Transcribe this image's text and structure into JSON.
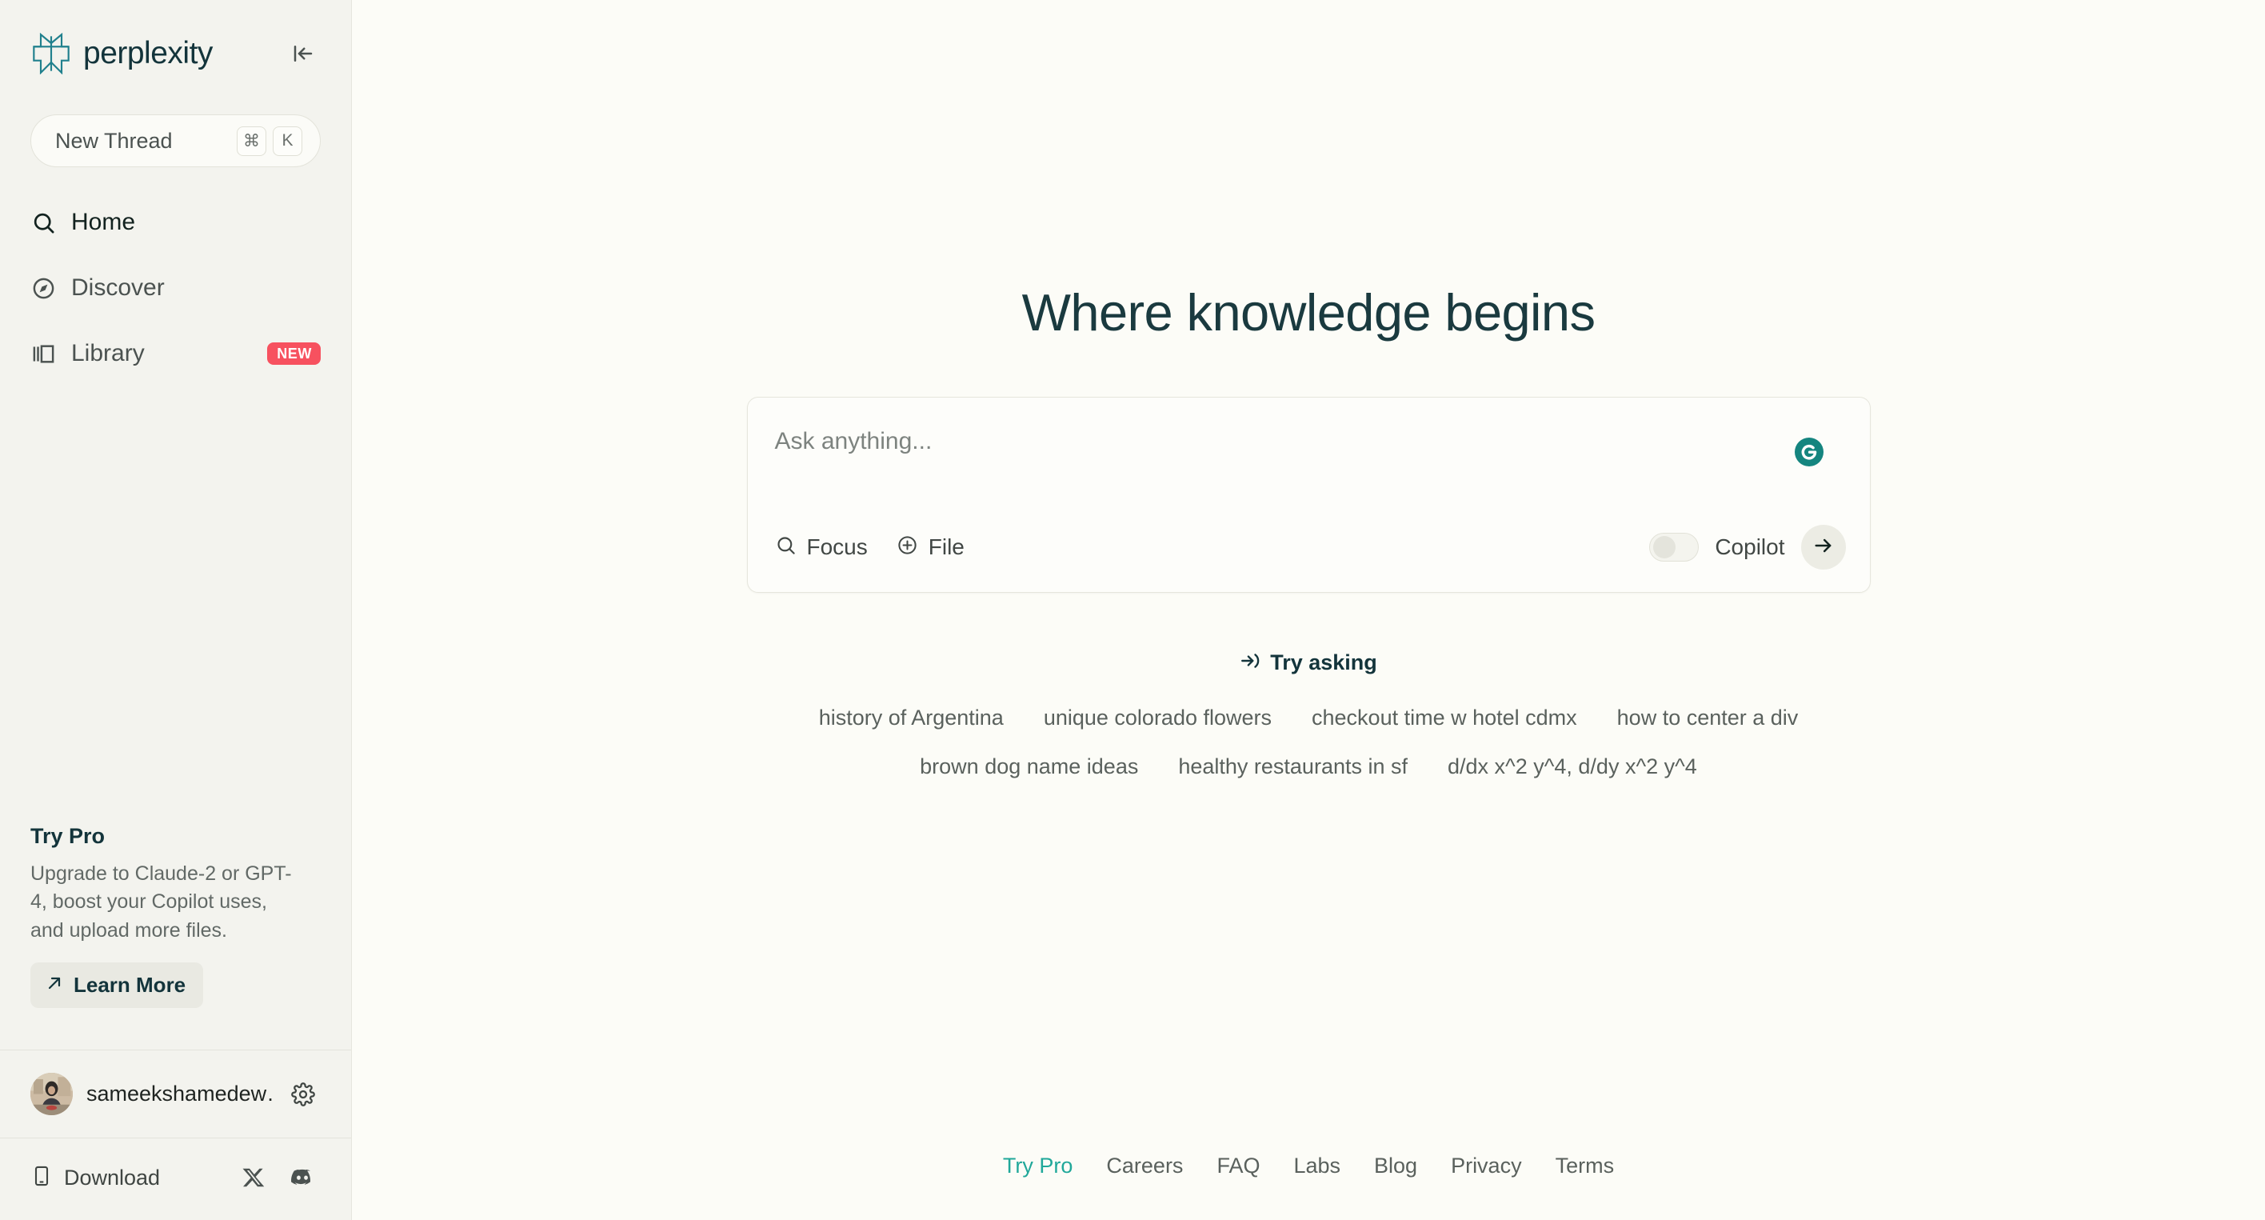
{
  "sidebar": {
    "brand": {
      "name": "perplexity",
      "logo_icon": "perplexity-logo-icon"
    },
    "collapse_icon": "collapse-sidebar-icon",
    "new_thread": {
      "label": "New Thread",
      "keys": [
        "⌘",
        "K"
      ]
    },
    "nav": [
      {
        "label": "Home",
        "icon": "search-icon",
        "active": true
      },
      {
        "label": "Discover",
        "icon": "compass-icon",
        "active": false
      },
      {
        "label": "Library",
        "icon": "library-icon",
        "active": false,
        "badge": "NEW"
      }
    ],
    "promo": {
      "title": "Try Pro",
      "text": "Upgrade to Claude-2 or GPT-4, boost your Copilot uses, and upload more files.",
      "button_label": "Learn More",
      "button_icon": "arrow-up-right-icon"
    },
    "account": {
      "name": "sameekshamedew…",
      "avatar_icon": "user-avatar",
      "settings_icon": "gear-icon"
    },
    "footer": {
      "download_label": "Download",
      "download_icon": "mobile-device-icon",
      "social": [
        {
          "name": "x-icon"
        },
        {
          "name": "discord-icon"
        }
      ]
    },
    "badge_color": "#f7515f"
  },
  "main": {
    "hero_title": "Where knowledge begins",
    "search": {
      "placeholder": "Ask anything...",
      "value": "",
      "grammarly_icon": "grammarly-icon",
      "tools": [
        {
          "label": "Focus",
          "icon": "search-icon"
        },
        {
          "label": "File",
          "icon": "plus-circle-icon"
        }
      ],
      "copilot": {
        "label": "Copilot",
        "enabled": false
      },
      "submit_icon": "arrow-right-icon"
    },
    "try_asking": {
      "label": "Try asking",
      "icon": "arrow-into-icon",
      "rows": [
        [
          "history of Argentina",
          "unique colorado flowers",
          "checkout time w hotel cdmx",
          "how to center a div"
        ],
        [
          "brown dog name ideas",
          "healthy restaurants in sf",
          "d/dx x^2 y^4, d/dy x^2 y^4"
        ]
      ]
    },
    "footer_links": [
      {
        "label": "Try Pro",
        "accent": true
      },
      {
        "label": "Careers",
        "accent": false
      },
      {
        "label": "FAQ",
        "accent": false
      },
      {
        "label": "Labs",
        "accent": false
      },
      {
        "label": "Blog",
        "accent": false
      },
      {
        "label": "Privacy",
        "accent": false
      },
      {
        "label": "Terms",
        "accent": false
      }
    ],
    "accent_color": "#20a89a"
  }
}
